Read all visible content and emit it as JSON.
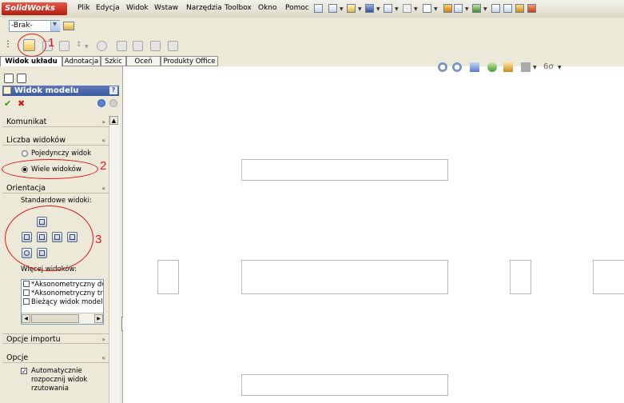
{
  "app": {
    "logo": "SolidWorks"
  },
  "menu": [
    "Plik",
    "Edycja",
    "Widok",
    "Wstaw",
    "Narzędzia",
    "Toolbox",
    "Okno",
    "Pomoc"
  ],
  "combo": {
    "value": "-Brak-"
  },
  "tabs": [
    "Widok układu",
    "Adnotacja",
    "Szkic",
    "Oceń",
    "Produkty Office"
  ],
  "panel": {
    "title": "Widok modelu",
    "help": "?",
    "sections": {
      "komunikat": "Komunikat",
      "liczba": "Liczba widoków",
      "orientacja": "Orientacja",
      "opcje_importu": "Opcje importu",
      "opcje": "Opcje"
    },
    "radio_single": "Pojedynczy widok",
    "radio_multi": "Wiele widoków",
    "standard_views_label": "Standardowe widoki:",
    "more_views_label": "Więcej widoków:",
    "more_views": [
      "*Aksonometryczny dw",
      "*Aksonometryczny tró",
      "Bieżący widok modelu"
    ],
    "auto_start": [
      "Automatycznie",
      "rozpocznij widok",
      "rzutowania"
    ]
  },
  "annotations": [
    "1",
    "2",
    "3"
  ],
  "colors": {
    "accent": "#3c5aa0",
    "annotation": "#e01818"
  }
}
